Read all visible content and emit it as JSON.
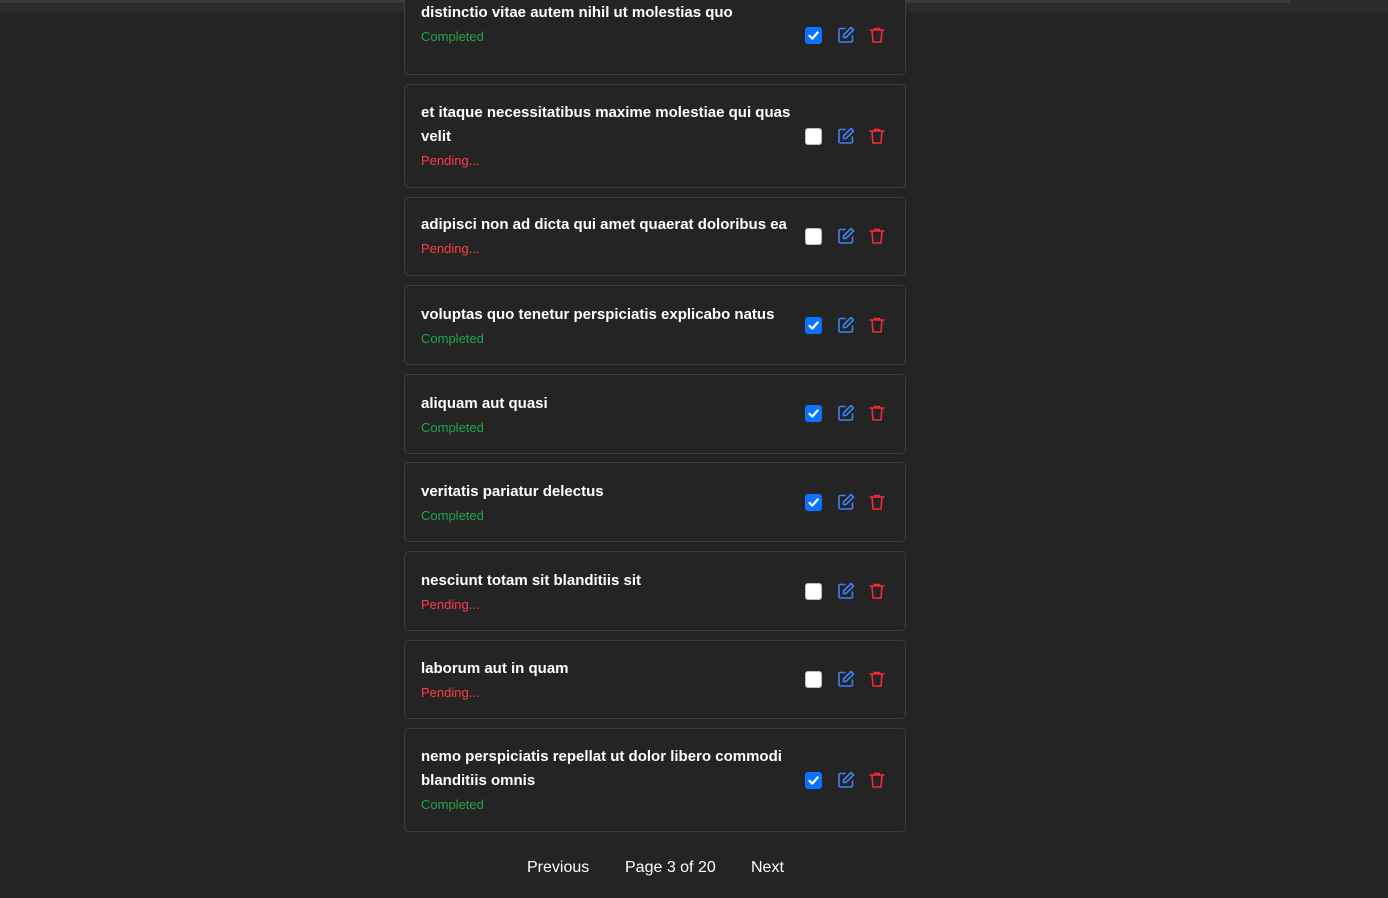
{
  "todos": [
    {
      "title": "distinctio vitae autem nihil ut molestias quo",
      "status": "Completed",
      "completed": true
    },
    {
      "title": "et itaque necessitatibus maxime molestiae qui quas velit",
      "status": "Pending...",
      "completed": false
    },
    {
      "title": "adipisci non ad dicta qui amet quaerat doloribus ea",
      "status": "Pending...",
      "completed": false
    },
    {
      "title": "voluptas quo tenetur perspiciatis explicabo natus",
      "status": "Completed",
      "completed": true
    },
    {
      "title": "aliquam aut quasi",
      "status": "Completed",
      "completed": true
    },
    {
      "title": "veritatis pariatur delectus",
      "status": "Completed",
      "completed": true
    },
    {
      "title": "nesciunt totam sit blanditiis sit",
      "status": "Pending...",
      "completed": false
    },
    {
      "title": "laborum aut in quam",
      "status": "Pending...",
      "completed": false
    },
    {
      "title": "nemo perspiciatis repellat ut dolor libero commodi blanditiis omnis",
      "status": "Completed",
      "completed": true
    }
  ],
  "pagination": {
    "previous_label": "Previous",
    "page_info": "Page 3 of 20",
    "next_label": "Next"
  },
  "colors": {
    "completed": "#1fa64a",
    "pending": "#ff3b4a",
    "edit": "#3b82f6",
    "delete": "#ef2b3a",
    "checkbox": "#0a73ff"
  },
  "icons": {
    "edit": "edit-icon",
    "delete": "trash-icon",
    "check": "check-icon"
  }
}
